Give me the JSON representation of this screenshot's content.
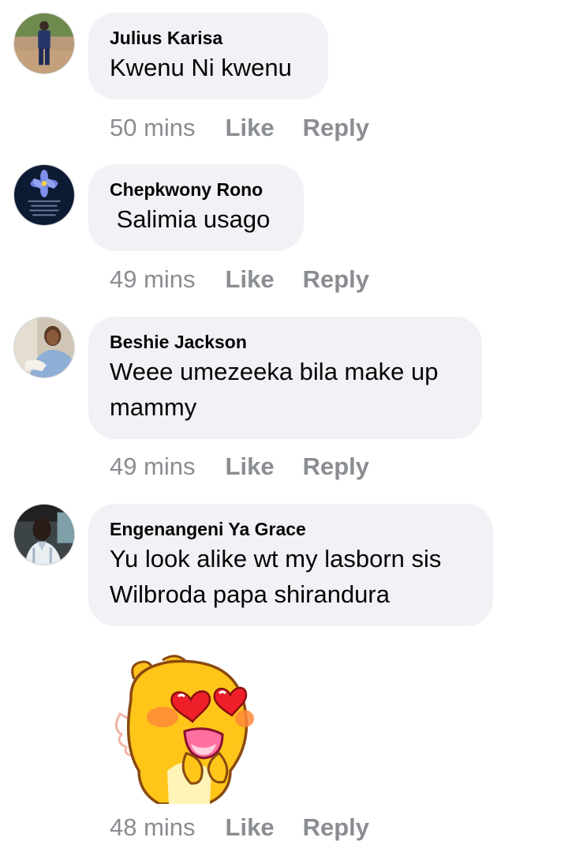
{
  "comments": [
    {
      "author": "Julius Karisa",
      "text": "Kwenu Ni kwenu",
      "time": "50 mins",
      "like": "Like",
      "reply": "Reply"
    },
    {
      "author": "Chepkwony Rono",
      "text": " Salimia usago",
      "time": "49 mins",
      "like": "Like",
      "reply": "Reply"
    },
    {
      "author": "Beshie Jackson",
      "text": "Weee umezeeka bila make up mammy",
      "time": "49 mins",
      "like": "Like",
      "reply": "Reply"
    },
    {
      "author": "Engenangeni Ya Grace",
      "text": "Yu look alike wt my lasborn sis Wilbroda papa shirandura",
      "time": "48 mins",
      "like": "Like",
      "reply": "Reply"
    }
  ],
  "sticker": {
    "icon": "heart-eyes-chick-sticker-icon"
  },
  "colors": {
    "bubble": "#f0f2f5",
    "meta": "#8a8d91",
    "text": "#050505"
  }
}
